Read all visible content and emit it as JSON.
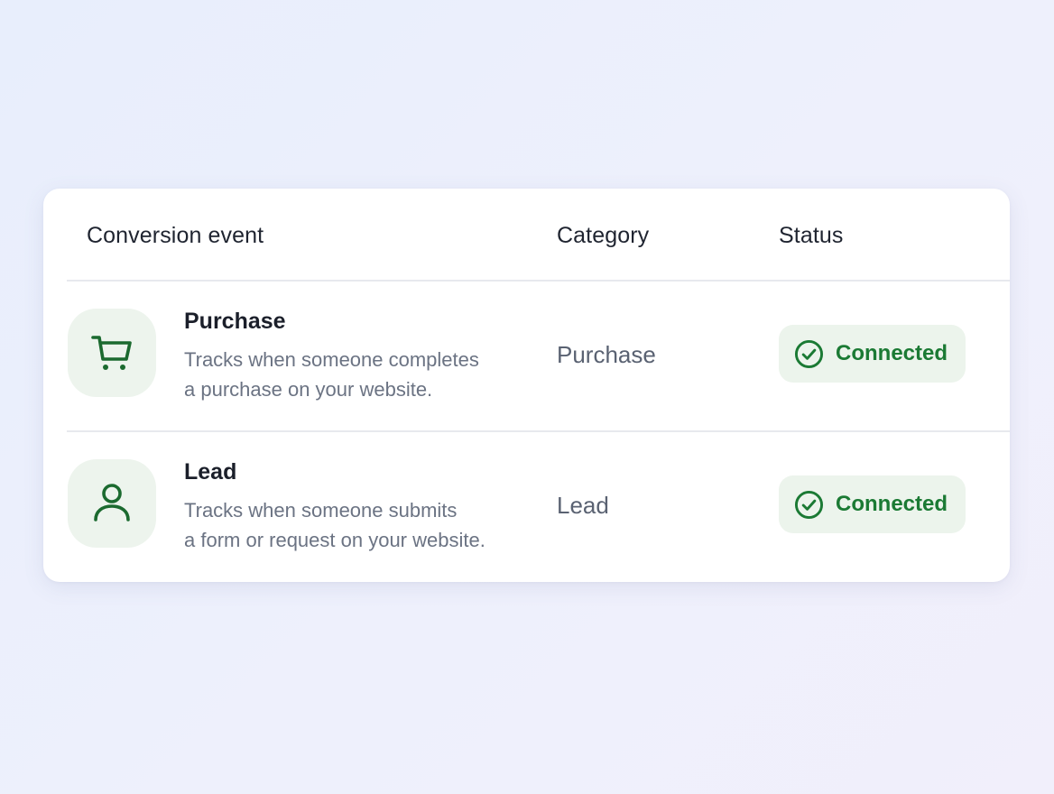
{
  "table": {
    "headers": {
      "event": "Conversion event",
      "category": "Category",
      "status": "Status"
    },
    "rows": [
      {
        "icon": "shopping-cart-icon",
        "title": "Purchase",
        "desc_line1": "Tracks when someone completes",
        "desc_line2": "a purchase on your website.",
        "category": "Purchase",
        "status": "Connected"
      },
      {
        "icon": "user-icon",
        "title": "Lead",
        "desc_line1": "Tracks when someone submits",
        "desc_line2": "a form or request on your website.",
        "category": "Lead",
        "status": "Connected"
      }
    ]
  },
  "colors": {
    "accent_green": "#1b7a34",
    "badge_bg": "#ecf4ec",
    "icon_tile_bg": "#edf4ed"
  }
}
